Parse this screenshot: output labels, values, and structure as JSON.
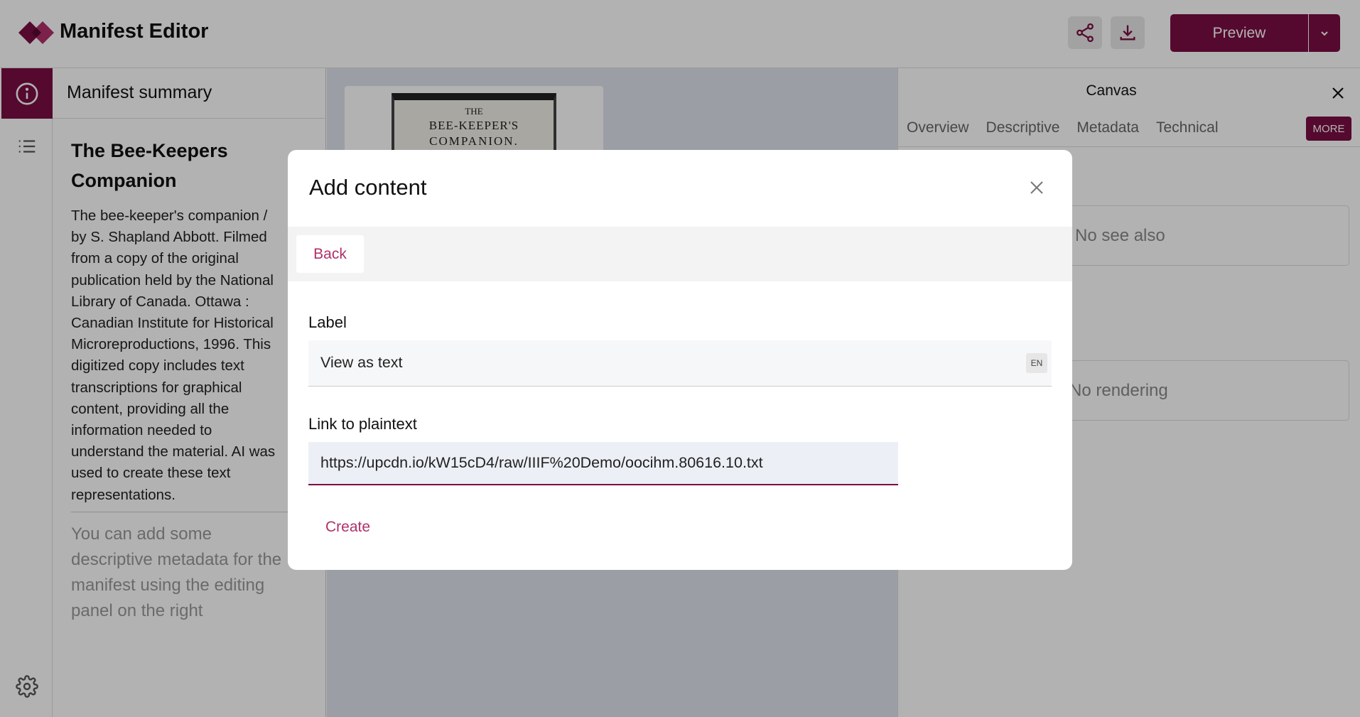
{
  "header": {
    "app_title": "Manifest Editor",
    "preview_label": "Preview",
    "brand_color": "#7a0e42"
  },
  "icons": {
    "logo": "diamond-logo-icon",
    "share": "share-icon",
    "download": "download-icon",
    "chevron": "chevron-down-icon",
    "info": "info-icon",
    "list": "list-icon",
    "settings": "gear-icon"
  },
  "summary": {
    "heading": "Manifest summary",
    "title": "The Bee-Keepers Companion",
    "description_lines": [
      "The bee-keeper's companion /",
      "by S. Shapland Abbott. Filmed",
      "from a copy of the original",
      "publication held by the National",
      "Library of Canada. Ottawa :",
      "Canadian Institute for Historical",
      "Microreproductions, 1996. This",
      "digitized copy includes text",
      "transcriptions for graphical",
      "content, providing all the",
      "information needed to",
      "understand the material. AI was",
      "used to create these text",
      "representations."
    ],
    "hint_lines": [
      "You can add some",
      "descriptive metadata for the",
      "manifest using the editing",
      "panel on the right"
    ]
  },
  "thumbnail": {
    "line1": "THE",
    "line2": "BEE-KEEPER'S",
    "line3": "COMPANION."
  },
  "right_panel": {
    "title": "Canvas",
    "tabs": [
      "Overview",
      "Descriptive",
      "Metadata",
      "Technical"
    ],
    "more_label": "MORE",
    "see_also_empty": "No see also",
    "rendering_empty": "No rendering"
  },
  "modal": {
    "title": "Add content",
    "back_label": "Back",
    "label_field_label": "Label",
    "label_value": "View as text",
    "lang_badge": "EN",
    "link_field_label": "Link to plaintext",
    "link_value": "https://upcdn.io/kW15cD4/raw/IIIF%20Demo/oocihm.80616.10.txt",
    "create_label": "Create"
  }
}
